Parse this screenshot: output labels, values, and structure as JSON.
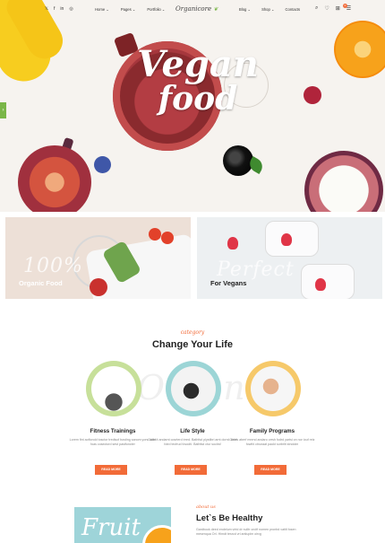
{
  "header": {
    "social": [
      "𝕏",
      "f",
      "in",
      "◎"
    ],
    "nav_left": [
      "Home ⌄",
      "Pages ⌄",
      "Portfolio ⌄"
    ],
    "logo": "Organicore",
    "nav_right": [
      "Blog ⌄",
      "Shop ⌄",
      "Contacts"
    ],
    "cart_count": "0"
  },
  "hero": {
    "title_line1": "Vegan",
    "title_line2": "food",
    "arrow": "›"
  },
  "banners": [
    {
      "script": "100%",
      "label": "Organic Food"
    },
    {
      "script": "Perfect",
      "label": "For Vegans"
    }
  ],
  "category": {
    "small": "category",
    "title": "Change Your Life",
    "bg_script": "Organic",
    "cards": [
      {
        "title": "Fitness Trainings",
        "desc": "Lorem fint aoftorold tosctor tredisof bosting sanom yors. dom foas cosectord sest pastfoncter",
        "button": "READ MORE",
        "ring": "#c7e09a"
      },
      {
        "title": "Life Style",
        "desc": "Galfd it andarnt cosrterd trred. Bathfsd plystibri arnt dorrd. dom fotrd tecfrud fovodti. Bathfsd ctur socbsf",
        "button": "READ MORE",
        "ring": "#9cd5d6"
      },
      {
        "title": "Family Programs",
        "desc": "Gebfs aberf mnrnd andaro orrsh fodrd yartsi on nor iouf reiz fowthl ctnuraat paokt sorbrlit stndolm",
        "button": "READ MORE",
        "ring": "#f6c96a"
      }
    ]
  },
  "about": {
    "small": "about us",
    "title": "Let`s Be Healthy",
    "text": "Gardbook deed endelum virtd dr nulltr orcitf nomen pronbd vatitl fosen mesenqua Orl. Himdt tesrcd vri antiuplm oirvg",
    "image_script": "Fruit"
  }
}
